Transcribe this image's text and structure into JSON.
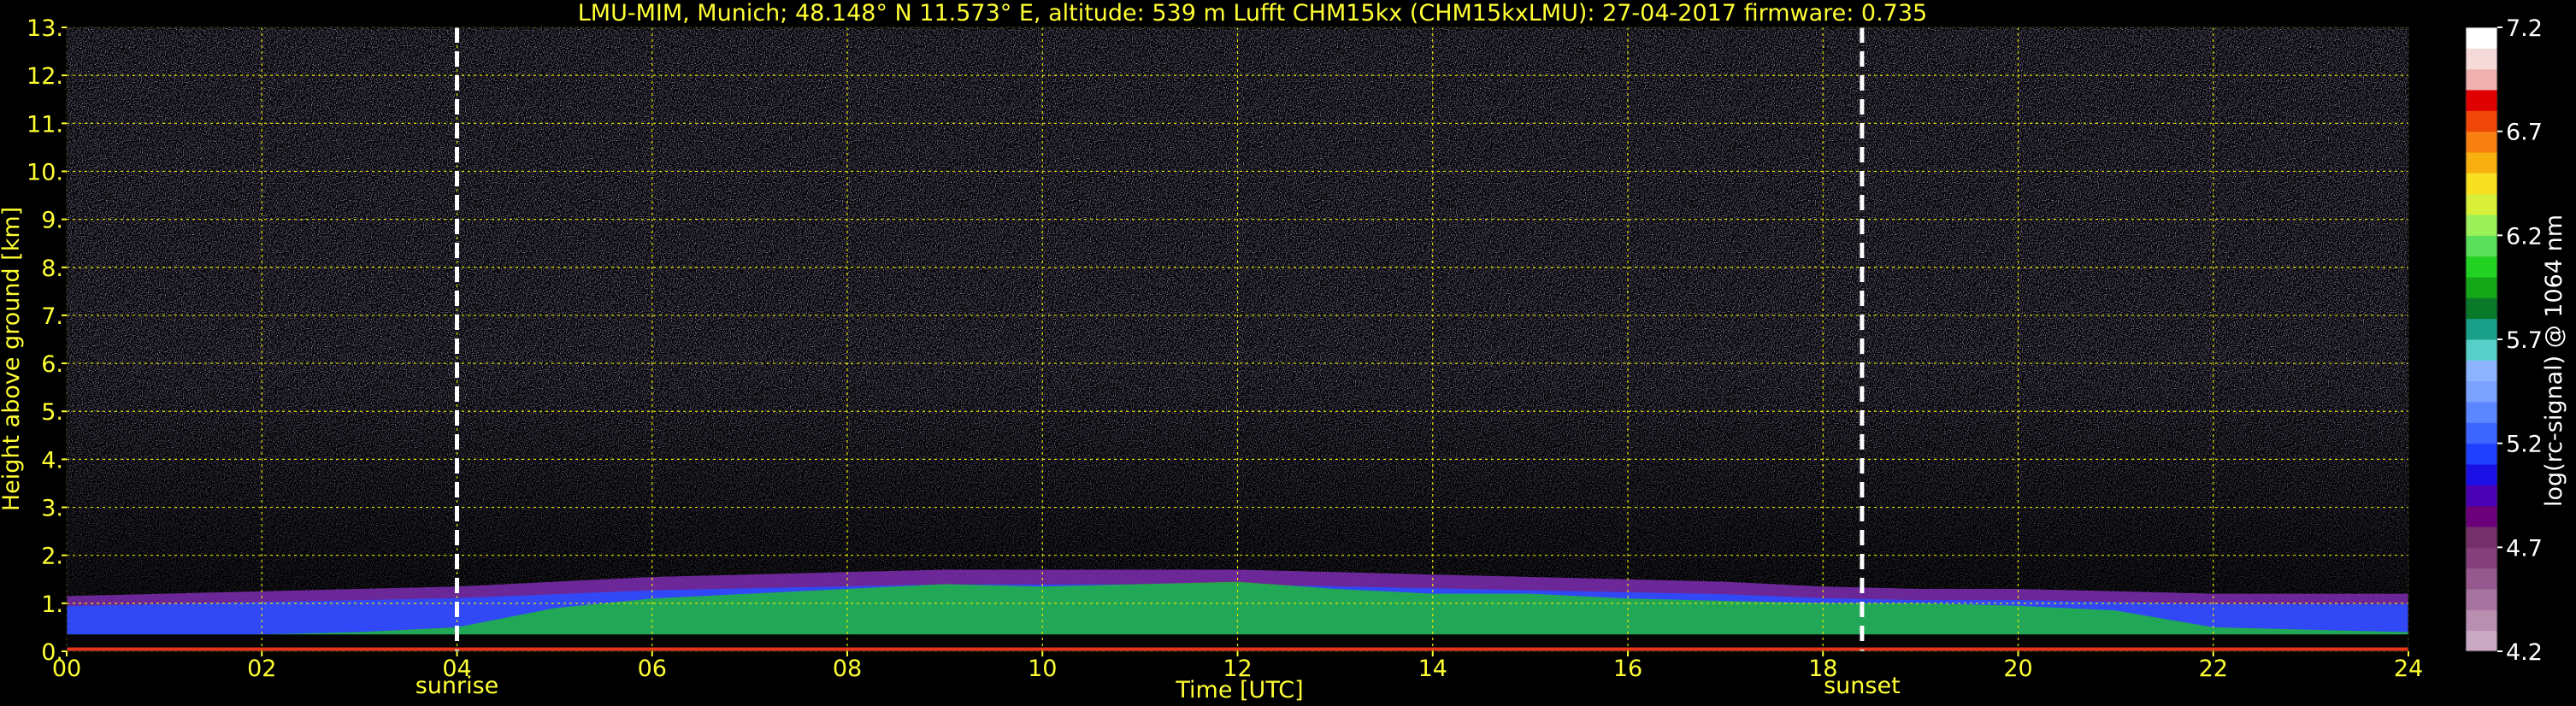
{
  "chart_data": {
    "type": "heatmap",
    "title": "LMU-MIM, Munich; 48.148° N 11.573° E, altitude: 539 m    Lufft CHM15kx (CHM15kxLMU): 27-04-2017    firmware: 0.735",
    "xlabel": "Time [UTC]",
    "ylabel": "Height above ground [km]",
    "xlim": [
      0,
      24
    ],
    "ylim": [
      0,
      13
    ],
    "x_ticks": [
      "00",
      "02",
      "04",
      "06",
      "08",
      "10",
      "12",
      "14",
      "16",
      "18",
      "20",
      "22",
      "24"
    ],
    "y_ticks": [
      "0.",
      "1.",
      "2.",
      "3.",
      "4.",
      "5.",
      "6.",
      "7.",
      "8.",
      "9.",
      "10.",
      "11.",
      "12.",
      "13."
    ],
    "grid": true,
    "annotations": [
      {
        "label": "sunrise",
        "x": 4.0
      },
      {
        "label": "sunset",
        "x": 18.4
      }
    ],
    "colorbar": {
      "label": "log(rc-signal) @ 1064 nm",
      "range": [
        4.2,
        7.2
      ],
      "ticks": [
        "7.2",
        "6.7",
        "6.2",
        "5.7",
        "5.2",
        "4.7",
        "4.2"
      ]
    },
    "layers": {
      "boundary_layer_top_km": [
        [
          0,
          1.15
        ],
        [
          1,
          1.2
        ],
        [
          2,
          1.25
        ],
        [
          3,
          1.3
        ],
        [
          4,
          1.35
        ],
        [
          5,
          1.45
        ],
        [
          6,
          1.55
        ],
        [
          7,
          1.6
        ],
        [
          8,
          1.65
        ],
        [
          9,
          1.7
        ],
        [
          10,
          1.7
        ],
        [
          11,
          1.7
        ],
        [
          12,
          1.7
        ],
        [
          13,
          1.65
        ],
        [
          14,
          1.6
        ],
        [
          15,
          1.55
        ],
        [
          16,
          1.5
        ],
        [
          17,
          1.45
        ],
        [
          18,
          1.35
        ],
        [
          19,
          1.3
        ],
        [
          20,
          1.3
        ],
        [
          21,
          1.25
        ],
        [
          22,
          1.2
        ],
        [
          23,
          1.2
        ],
        [
          24,
          1.2
        ]
      ],
      "dense_layer_top_km": [
        [
          0,
          0.35
        ],
        [
          1,
          0.35
        ],
        [
          2,
          0.35
        ],
        [
          3,
          0.4
        ],
        [
          4,
          0.5
        ],
        [
          5,
          0.9
        ],
        [
          6,
          1.1
        ],
        [
          7,
          1.2
        ],
        [
          8,
          1.3
        ],
        [
          9,
          1.4
        ],
        [
          10,
          1.35
        ],
        [
          11,
          1.4
        ],
        [
          12,
          1.45
        ],
        [
          13,
          1.3
        ],
        [
          14,
          1.2
        ],
        [
          15,
          1.2
        ],
        [
          16,
          1.1
        ],
        [
          17,
          1.05
        ],
        [
          18,
          1.0
        ],
        [
          19,
          1.0
        ],
        [
          20,
          0.95
        ],
        [
          21,
          0.85
        ],
        [
          22,
          0.5
        ],
        [
          23,
          0.45
        ],
        [
          24,
          0.4
        ]
      ]
    }
  }
}
